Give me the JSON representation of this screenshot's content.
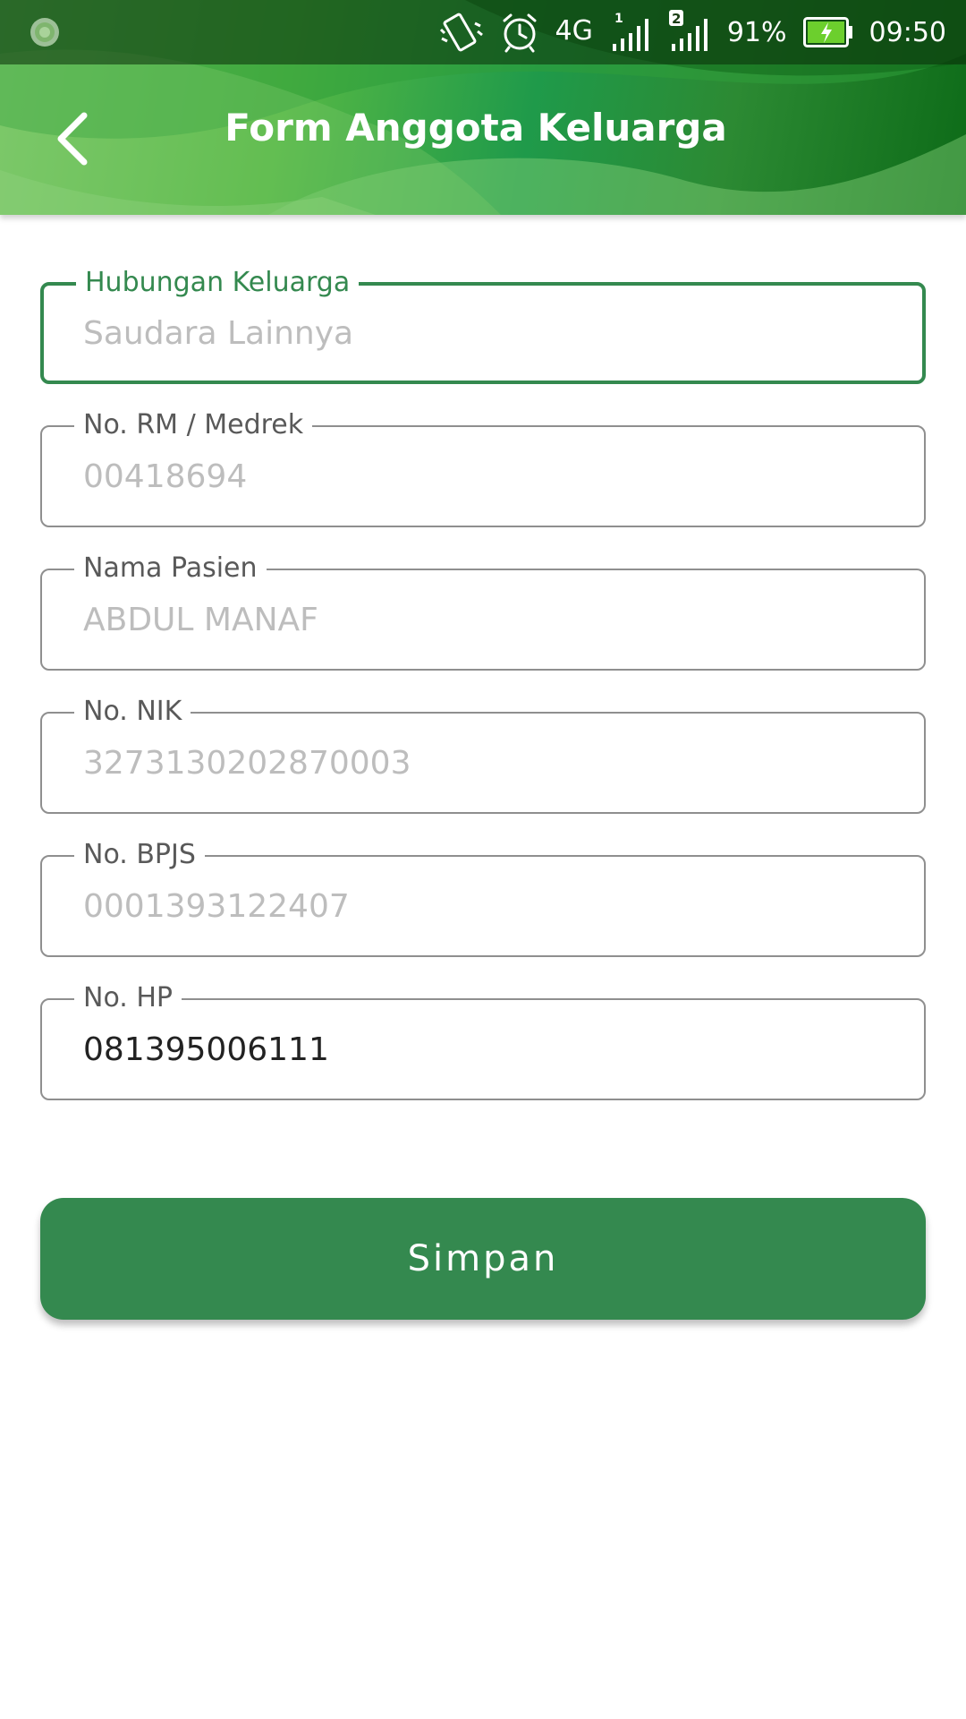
{
  "status_bar": {
    "network_type": "4G",
    "sim1_label": "1",
    "sim2_label": "2",
    "battery": "91%",
    "time": "09:50",
    "icons": [
      "app-notification-icon",
      "vibrate-icon",
      "alarm-icon",
      "signal-sim1-icon",
      "signal-sim2-icon",
      "battery-charging-icon"
    ]
  },
  "toolbar": {
    "title": "Form Anggota Keluarga",
    "back_icon": "chevron-left-icon"
  },
  "colors": {
    "primary": "#34894f",
    "header_green_light": "#7fc96b",
    "header_green_dark": "#0d6b18",
    "placeholder": "#bdbdbd",
    "border": "#8f8f8f"
  },
  "form": {
    "hubungan": {
      "label": "Hubungan Keluarga",
      "placeholder": "Saudara Lainnya",
      "value": ""
    },
    "no_rm": {
      "label": "No. RM / Medrek",
      "placeholder": "00418694",
      "value": ""
    },
    "nama_pasien": {
      "label": "Nama Pasien",
      "placeholder": "ABDUL MANAF",
      "value": ""
    },
    "no_nik": {
      "label": "No. NIK",
      "placeholder": "3273130202870003",
      "value": ""
    },
    "no_bpjs": {
      "label": "No. BPJS",
      "placeholder": "0001393122407",
      "value": ""
    },
    "no_hp": {
      "label": "No. HP",
      "placeholder": "",
      "value": "081395006111"
    }
  },
  "actions": {
    "save_label": "Simpan"
  }
}
